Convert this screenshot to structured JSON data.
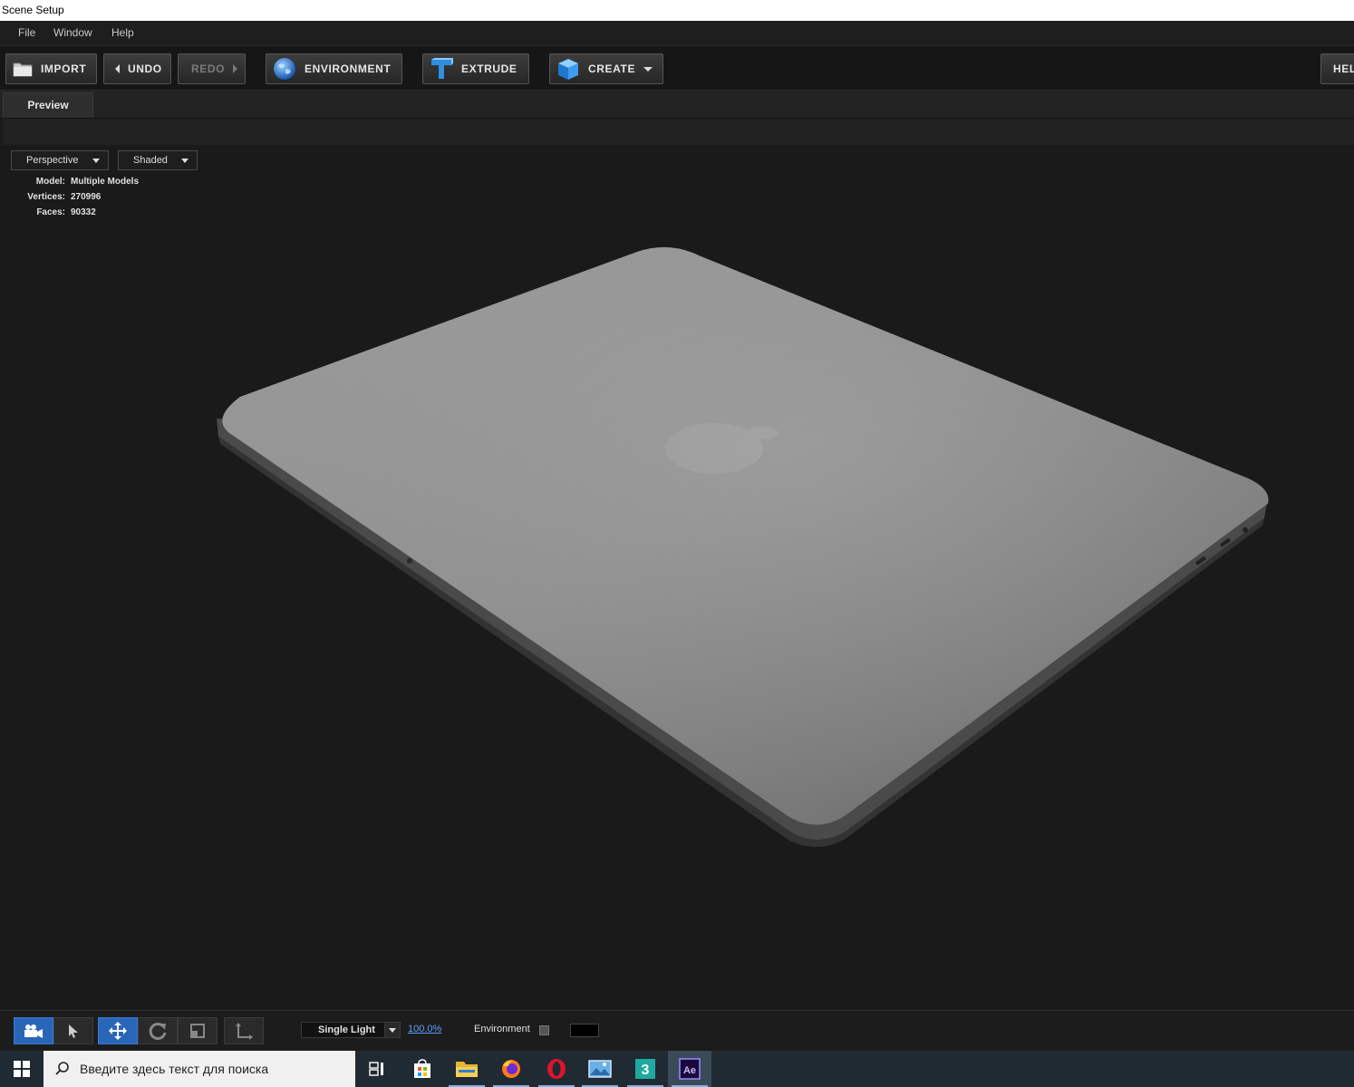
{
  "window": {
    "title": "Scene Setup"
  },
  "menu": {
    "items": [
      "File",
      "Window",
      "Help"
    ]
  },
  "toolbar": {
    "import": "IMPORT",
    "undo": "UNDO",
    "redo": "REDO",
    "environment": "ENVIRONMENT",
    "extrude": "EXTRUDE",
    "create": "CREATE",
    "help": "HEL"
  },
  "tabs": {
    "preview": "Preview"
  },
  "viewport": {
    "camera_mode": "Perspective",
    "render_mode": "Shaded",
    "stats": [
      {
        "key": "Model:",
        "value": "Multiple Models"
      },
      {
        "key": "Vertices:",
        "value": "270996"
      },
      {
        "key": "Faces:",
        "value": "90332"
      }
    ]
  },
  "statusbar": {
    "tools": [
      "camera-tool",
      "select-tool",
      "move-tool",
      "rotate-tool",
      "scale-tool",
      "axis-tool"
    ],
    "active_tool": "move-tool",
    "lighting": "Single Light",
    "light_intensity": "100.0%",
    "environment_label": "Environment",
    "environment_enabled": false
  },
  "taskbar": {
    "search_placeholder": "Введите здесь текст для поиска",
    "apps": [
      "task-view",
      "store",
      "file-explorer",
      "firefox",
      "opera",
      "photos",
      "3ds-max",
      "after-effects"
    ],
    "active_app": "after-effects"
  },
  "colors": {
    "accent": "#2a66b8",
    "background": "#1a1a1a",
    "link": "#5aa0ff"
  }
}
